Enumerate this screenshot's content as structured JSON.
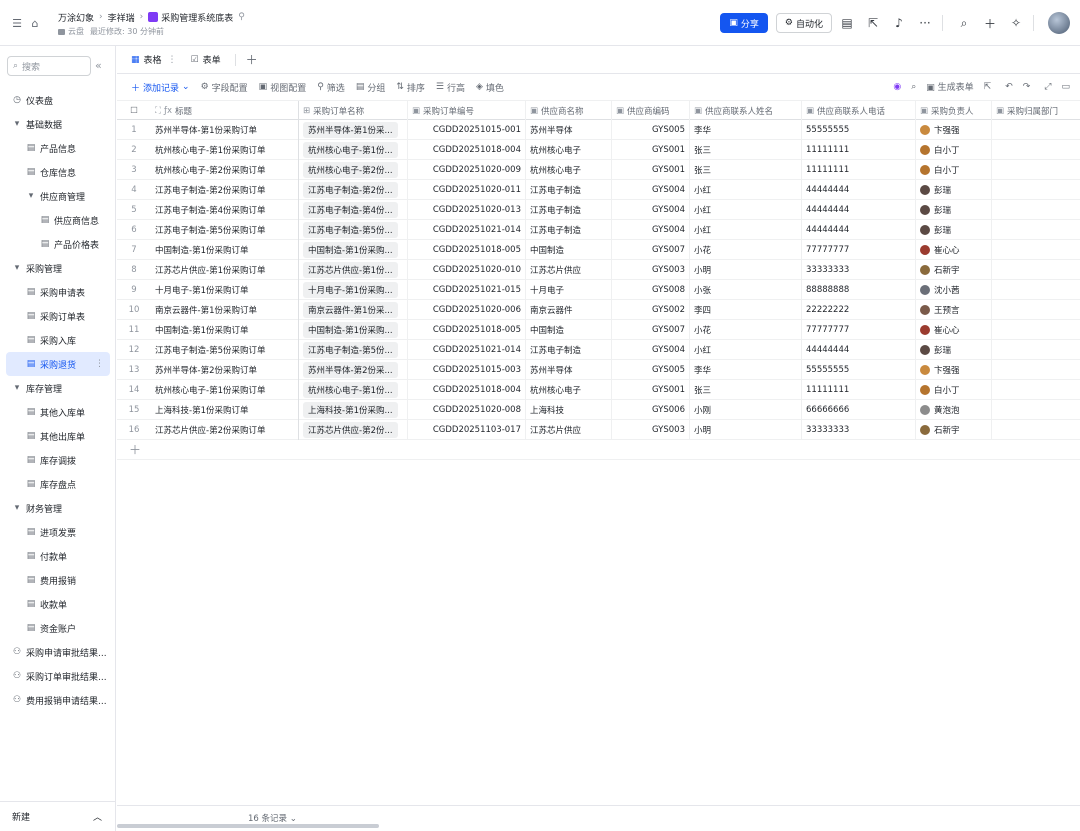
{
  "header": {
    "crumbs": [
      "万涂幻象",
      "李祥瑞",
      "采购管理系统底表"
    ],
    "location": "云盘",
    "modified": "最近修改: 30 分钟前",
    "share_label": "分享",
    "automation_label": "自动化"
  },
  "sidebar": {
    "search_placeholder": "搜索",
    "items": [
      {
        "label": "仪表盘",
        "level": 0,
        "icon": "◷"
      },
      {
        "label": "基础数据",
        "level": 0,
        "icon": "▾"
      },
      {
        "label": "产品信息",
        "level": 1,
        "icon": "▤"
      },
      {
        "label": "仓库信息",
        "level": 1,
        "icon": "▤"
      },
      {
        "label": "供应商管理",
        "level": 1,
        "icon": "▾"
      },
      {
        "label": "供应商信息",
        "level": 2,
        "icon": "▤"
      },
      {
        "label": "产品价格表",
        "level": 2,
        "icon": "▤"
      },
      {
        "label": "采购管理",
        "level": 0,
        "icon": "▾"
      },
      {
        "label": "采购申请表",
        "level": 1,
        "icon": "▤"
      },
      {
        "label": "采购订单表",
        "level": 1,
        "icon": "▤"
      },
      {
        "label": "采购入库",
        "level": 1,
        "icon": "▤"
      },
      {
        "label": "采购退货",
        "level": 1,
        "icon": "▤",
        "active": true
      },
      {
        "label": "库存管理",
        "level": 0,
        "icon": "▾"
      },
      {
        "label": "其他入库单",
        "level": 1,
        "icon": "▤"
      },
      {
        "label": "其他出库单",
        "level": 1,
        "icon": "▤"
      },
      {
        "label": "库存调拨",
        "level": 1,
        "icon": "▤"
      },
      {
        "label": "库存盘点",
        "level": 1,
        "icon": "▤"
      },
      {
        "label": "财务管理",
        "level": 0,
        "icon": "▾"
      },
      {
        "label": "进项发票",
        "level": 1,
        "icon": "▤"
      },
      {
        "label": "付款单",
        "level": 1,
        "icon": "▤"
      },
      {
        "label": "费用报销",
        "level": 1,
        "icon": "▤"
      },
      {
        "label": "收款单",
        "level": 1,
        "icon": "▤"
      },
      {
        "label": "资金账户",
        "level": 1,
        "icon": "▤"
      },
      {
        "label": "采购申请审批结果...",
        "level": 0,
        "icon": "⚇"
      },
      {
        "label": "采购订单审批结果...",
        "level": 0,
        "icon": "⚇"
      },
      {
        "label": "费用报销申请结果...",
        "level": 0,
        "icon": "⚇"
      }
    ],
    "footer_label": "新建"
  },
  "tabs": [
    {
      "label": "表格",
      "active": true
    },
    {
      "label": "表单",
      "active": false
    }
  ],
  "toolbar": {
    "add_record": "添加记录",
    "field_config": "字段配置",
    "view_config": "视图配置",
    "filter": "筛选",
    "group": "分组",
    "sort": "排序",
    "row_height": "行高",
    "fill_color": "填色",
    "generate_form": "生成表单"
  },
  "table": {
    "columns": [
      "标题",
      "采购订单名称",
      "采购订单编号",
      "供应商名称",
      "供应商编码",
      "供应商联系人姓名",
      "供应商联系人电话",
      "采购负责人",
      "采购归属部门"
    ],
    "rows": [
      [
        "1",
        "苏州半导体-第1份采购订单",
        "苏州半导体-第1份采...",
        "CGDD20251015-001",
        "苏州半导体",
        "GYS005",
        "李华",
        "55555555",
        "卞强强"
      ],
      [
        "2",
        "杭州核心电子-第1份采购订单",
        "杭州核心电子-第1份...",
        "CGDD20251018-004",
        "杭州核心电子",
        "GYS001",
        "张三",
        "11111111",
        "白小丁"
      ],
      [
        "3",
        "杭州核心电子-第2份采购订单",
        "杭州核心电子-第2份...",
        "CGDD20251020-009",
        "杭州核心电子",
        "GYS001",
        "张三",
        "11111111",
        "白小丁"
      ],
      [
        "4",
        "江苏电子制造-第2份采购订单",
        "江苏电子制造-第2份...",
        "CGDD20251020-011",
        "江苏电子制造",
        "GYS004",
        "小红",
        "44444444",
        "彭瑞"
      ],
      [
        "5",
        "江苏电子制造-第4份采购订单",
        "江苏电子制造-第4份...",
        "CGDD20251020-013",
        "江苏电子制造",
        "GYS004",
        "小红",
        "44444444",
        "彭瑞"
      ],
      [
        "6",
        "江苏电子制造-第5份采购订单",
        "江苏电子制造-第5份...",
        "CGDD20251021-014",
        "江苏电子制造",
        "GYS004",
        "小红",
        "44444444",
        "彭瑞"
      ],
      [
        "7",
        "中国制造-第1份采购订单",
        "中国制造-第1份采购...",
        "CGDD20251018-005",
        "中国制造",
        "GYS007",
        "小花",
        "77777777",
        "崔心心"
      ],
      [
        "8",
        "江苏芯片供应-第1份采购订单",
        "江苏芯片供应-第1份...",
        "CGDD20251020-010",
        "江苏芯片供应",
        "GYS003",
        "小明",
        "33333333",
        "石新宇"
      ],
      [
        "9",
        "十月电子-第1份采购订单",
        "十月电子-第1份采购...",
        "CGDD20251021-015",
        "十月电子",
        "GYS008",
        "小张",
        "88888888",
        "沈小茜"
      ],
      [
        "10",
        "南京云器件-第1份采购订单",
        "南京云器件-第1份采...",
        "CGDD20251020-006",
        "南京云器件",
        "GYS002",
        "李四",
        "22222222",
        "王预言"
      ],
      [
        "11",
        "中国制造-第1份采购订单",
        "中国制造-第1份采购...",
        "CGDD20251018-005",
        "中国制造",
        "GYS007",
        "小花",
        "77777777",
        "崔心心"
      ],
      [
        "12",
        "江苏电子制造-第5份采购订单",
        "江苏电子制造-第5份...",
        "CGDD20251021-014",
        "江苏电子制造",
        "GYS004",
        "小红",
        "44444444",
        "彭瑞"
      ],
      [
        "13",
        "苏州半导体-第2份采购订单",
        "苏州半导体-第2份采...",
        "CGDD20251015-003",
        "苏州半导体",
        "GYS005",
        "李华",
        "55555555",
        "卞强强"
      ],
      [
        "14",
        "杭州核心电子-第1份采购订单",
        "杭州核心电子-第1份...",
        "CGDD20251018-004",
        "杭州核心电子",
        "GYS001",
        "张三",
        "11111111",
        "白小丁"
      ],
      [
        "15",
        "上海科技-第1份采购订单",
        "上海科技-第1份采购...",
        "CGDD20251020-008",
        "上海科技",
        "GYS006",
        "小刚",
        "66666666",
        "黄泡泡"
      ],
      [
        "16",
        "江苏芯片供应-第2份采购订单",
        "江苏芯片供应-第2份...",
        "CGDD20251103-017",
        "江苏芯片供应",
        "GYS003",
        "小明",
        "33333333",
        "石新宇"
      ]
    ],
    "record_count": "16 条记录"
  },
  "colors": {
    "accent": "#1456f0",
    "active_nav_bg": "#e1eaff"
  }
}
